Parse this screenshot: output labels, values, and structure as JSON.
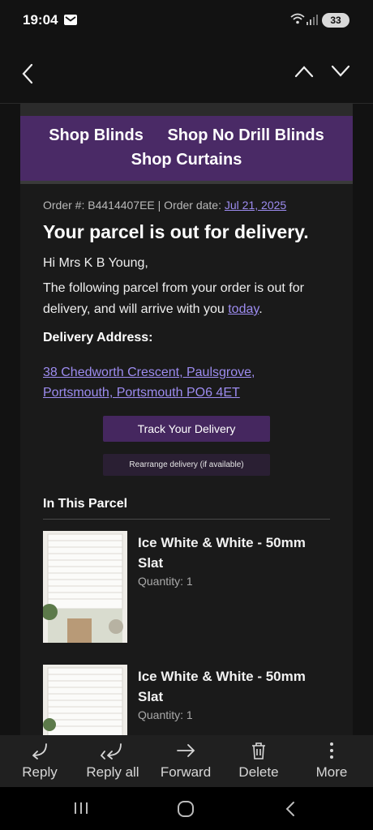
{
  "status_bar": {
    "time": "19:04",
    "battery": "33"
  },
  "banner": {
    "links": [
      "Shop Blinds",
      "Shop No Drill Blinds"
    ],
    "link3": "Shop Curtains"
  },
  "order": {
    "prefix": "Order #: B4414407EE | Order date: ",
    "date": "Jul 21, 2025"
  },
  "title": "Your parcel is out for delivery.",
  "greeting": "Hi Mrs K B Young,",
  "message": {
    "text": "The following parcel from your order is out for delivery, and will arrive with you ",
    "link": "today",
    "end": "."
  },
  "delivery": {
    "label": "Delivery Address:",
    "line1": "38 Chedworth Crescent, Paulsgrove,",
    "line2": "Portsmouth, Portsmouth PO6 4ET"
  },
  "buttons": {
    "track": "Track Your Delivery",
    "rearrange": "Rearrange delivery (if available)"
  },
  "parcel": {
    "heading": "In This Parcel",
    "items": [
      {
        "name": "Ice White & White - 50mm Slat",
        "quantity": "Quantity: 1"
      },
      {
        "name": "Ice White & White - 50mm Slat",
        "quantity": "Quantity: 1"
      }
    ]
  },
  "actions": [
    "Reply",
    "Reply all",
    "Forward",
    "Delete",
    "More"
  ],
  "colors": {
    "accent": "#4a2a66",
    "link": "#9d8cf0",
    "background": "#121212"
  }
}
